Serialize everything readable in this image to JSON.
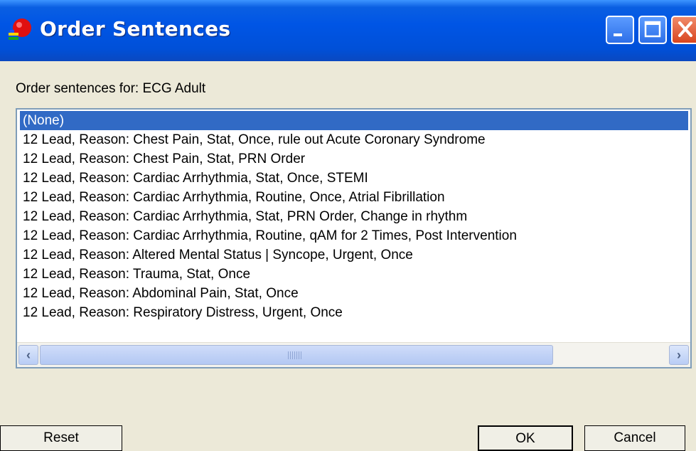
{
  "window": {
    "title": "Order Sentences"
  },
  "label": "Order sentences for:  ECG Adult",
  "list": {
    "items": [
      "(None)",
      "12 Lead, Reason: Chest Pain, Stat, Once, rule out Acute Coronary Syndrome",
      "12 Lead, Reason: Chest Pain, Stat, PRN Order",
      "12 Lead, Reason: Cardiac Arrhythmia, Stat, Once, STEMI",
      "12 Lead, Reason: Cardiac Arrhythmia, Routine, Once, Atrial Fibrillation",
      "12 Lead, Reason: Cardiac Arrhythmia, Stat, PRN Order, Change in rhythm",
      "12 Lead, Reason: Cardiac Arrhythmia, Routine, qAM for 2 Times, Post Intervention",
      "12 Lead, Reason: Altered Mental Status | Syncope, Urgent, Once",
      "12 Lead, Reason: Trauma, Stat, Once",
      "12 Lead, Reason: Abdominal Pain, Stat, Once",
      "12 Lead, Reason: Respiratory Distress, Urgent, Once"
    ],
    "selected_index": 0
  },
  "buttons": {
    "reset": "Reset",
    "ok": "OK",
    "cancel": "Cancel"
  },
  "icons": {
    "app": "app-icon",
    "minimize": "minimize-icon",
    "maximize": "maximize-icon",
    "close": "close-icon",
    "scroll_left": "chevron-left-icon",
    "scroll_right": "chevron-right-icon"
  },
  "colors": {
    "titlebar": "#0055e5",
    "selection": "#316ac5",
    "close_button": "#d8451f"
  }
}
